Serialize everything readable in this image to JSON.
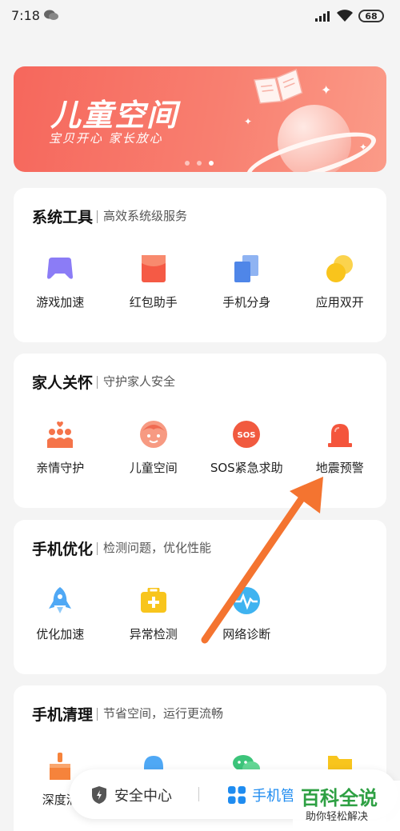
{
  "status_bar": {
    "time": "7:18",
    "battery": "68"
  },
  "banner": {
    "title": "儿童空间",
    "subtitle": "宝贝开心 家长放心"
  },
  "sections": [
    {
      "title": "系统工具",
      "subtitle": "高效系统级服务",
      "items": [
        {
          "label": "游戏加速",
          "icon": "gamepad-icon",
          "color": "#8b7cf6"
        },
        {
          "label": "红包助手",
          "icon": "red-envelope-icon",
          "color": "#f55a45"
        },
        {
          "label": "手机分身",
          "icon": "phone-clone-icon",
          "color": "#4f86e8"
        },
        {
          "label": "应用双开",
          "icon": "dual-apps-icon",
          "color": "#f9c41c"
        }
      ]
    },
    {
      "title": "家人关怀",
      "subtitle": "守护家人安全",
      "items": [
        {
          "label": "亲情守护",
          "icon": "family-guard-icon",
          "color": "#f5744a"
        },
        {
          "label": "儿童空间",
          "icon": "child-face-icon",
          "color": "#f79a82"
        },
        {
          "label": "SOS紧急求助",
          "icon": "sos-icon",
          "color": "#f15a3f"
        },
        {
          "label": "地震预警",
          "icon": "alarm-light-icon",
          "color": "#f4553c"
        }
      ]
    },
    {
      "title": "手机优化",
      "subtitle": "检测问题，优化性能",
      "items": [
        {
          "label": "优化加速",
          "icon": "rocket-icon",
          "color": "#4fa8f5"
        },
        {
          "label": "异常检测",
          "icon": "medical-kit-icon",
          "color": "#f8c51d"
        },
        {
          "label": "网络诊断",
          "icon": "network-pulse-icon",
          "color": "#3fb3f0"
        }
      ]
    },
    {
      "title": "手机清理",
      "subtitle": "节省空间，运行更流畅",
      "items": [
        {
          "label": "深度清",
          "icon": "broom-icon",
          "color": "#f6833b"
        },
        {
          "label": "",
          "icon": "bell-icon",
          "color": "#4fa8f5"
        },
        {
          "label": "",
          "icon": "wechat-icon",
          "color": "#3cc47a"
        },
        {
          "label": "",
          "icon": "folder-icon",
          "color": "#f8c51d"
        }
      ]
    }
  ],
  "bottom_bar": {
    "security_label": "安全中心",
    "manager_label": "手机管",
    "manager_color": "#1f8cf0"
  },
  "watermark": {
    "main": "百科全说",
    "sub": "助你轻松解决"
  },
  "annotation": {
    "arrow_color": "#f47430"
  }
}
